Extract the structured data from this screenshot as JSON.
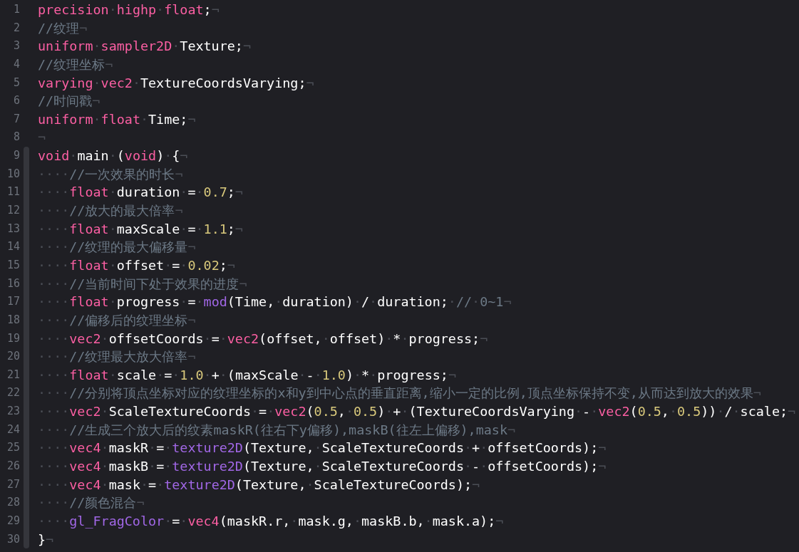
{
  "editor": {
    "lines": [
      {
        "number": "1",
        "tokens": [
          {
            "kind": "kw",
            "text": "precision"
          },
          {
            "kind": "ws",
            "text": "·"
          },
          {
            "kind": "kw",
            "text": "highp"
          },
          {
            "kind": "ws",
            "text": "·"
          },
          {
            "kind": "kw",
            "text": "float"
          },
          {
            "kind": "id",
            "text": ";"
          },
          {
            "kind": "ws",
            "text": "¬"
          }
        ]
      },
      {
        "number": "2",
        "tokens": [
          {
            "kind": "cm",
            "text": "//纹理"
          },
          {
            "kind": "ws",
            "text": "¬"
          }
        ]
      },
      {
        "number": "3",
        "tokens": [
          {
            "kind": "kw",
            "text": "uniform"
          },
          {
            "kind": "ws",
            "text": "·"
          },
          {
            "kind": "kw",
            "text": "sampler2D"
          },
          {
            "kind": "ws",
            "text": "·"
          },
          {
            "kind": "id",
            "text": "Texture;"
          },
          {
            "kind": "ws",
            "text": "¬"
          }
        ]
      },
      {
        "number": "4",
        "tokens": [
          {
            "kind": "cm",
            "text": "//纹理坐标"
          },
          {
            "kind": "ws",
            "text": "¬"
          }
        ]
      },
      {
        "number": "5",
        "tokens": [
          {
            "kind": "kw",
            "text": "varying"
          },
          {
            "kind": "ws",
            "text": "·"
          },
          {
            "kind": "kw",
            "text": "vec2"
          },
          {
            "kind": "ws",
            "text": "·"
          },
          {
            "kind": "id",
            "text": "TextureCoordsVarying;"
          },
          {
            "kind": "ws",
            "text": "¬"
          }
        ]
      },
      {
        "number": "6",
        "tokens": [
          {
            "kind": "cm",
            "text": "//时间戳"
          },
          {
            "kind": "ws",
            "text": "¬"
          }
        ]
      },
      {
        "number": "7",
        "tokens": [
          {
            "kind": "kw",
            "text": "uniform"
          },
          {
            "kind": "ws",
            "text": "·"
          },
          {
            "kind": "kw",
            "text": "float"
          },
          {
            "kind": "ws",
            "text": "·"
          },
          {
            "kind": "id",
            "text": "Time;"
          },
          {
            "kind": "ws",
            "text": "¬"
          }
        ]
      },
      {
        "number": "8",
        "tokens": [
          {
            "kind": "ws",
            "text": "¬"
          }
        ]
      }
    ],
    "block": {
      "lines": [
        {
          "number": "9",
          "tokens": [
            {
              "kind": "kw",
              "text": "void"
            },
            {
              "kind": "ws",
              "text": "·"
            },
            {
              "kind": "id",
              "text": "main"
            },
            {
              "kind": "ws",
              "text": "·"
            },
            {
              "kind": "id",
              "text": "("
            },
            {
              "kind": "kw",
              "text": "void"
            },
            {
              "kind": "id",
              "text": ")"
            },
            {
              "kind": "ws",
              "text": "·"
            },
            {
              "kind": "id",
              "text": "{"
            },
            {
              "kind": "ws",
              "text": "¬"
            }
          ]
        },
        {
          "number": "10",
          "tokens": [
            {
              "kind": "ws",
              "text": "····"
            },
            {
              "kind": "cm",
              "text": "//一次效果的时长"
            },
            {
              "kind": "ws",
              "text": "¬"
            }
          ]
        },
        {
          "number": "11",
          "tokens": [
            {
              "kind": "ws",
              "text": "····"
            },
            {
              "kind": "kw",
              "text": "float"
            },
            {
              "kind": "ws",
              "text": "·"
            },
            {
              "kind": "id",
              "text": "duration"
            },
            {
              "kind": "ws",
              "text": "·"
            },
            {
              "kind": "id",
              "text": "="
            },
            {
              "kind": "ws",
              "text": "·"
            },
            {
              "kind": "num",
              "text": "0.7"
            },
            {
              "kind": "id",
              "text": ";"
            },
            {
              "kind": "ws",
              "text": "¬"
            }
          ]
        },
        {
          "number": "12",
          "tokens": [
            {
              "kind": "ws",
              "text": "····"
            },
            {
              "kind": "cm",
              "text": "//放大的最大倍率"
            },
            {
              "kind": "ws",
              "text": "¬"
            }
          ]
        },
        {
          "number": "13",
          "tokens": [
            {
              "kind": "ws",
              "text": "····"
            },
            {
              "kind": "kw",
              "text": "float"
            },
            {
              "kind": "ws",
              "text": "·"
            },
            {
              "kind": "id",
              "text": "maxScale"
            },
            {
              "kind": "ws",
              "text": "·"
            },
            {
              "kind": "id",
              "text": "="
            },
            {
              "kind": "ws",
              "text": "·"
            },
            {
              "kind": "num",
              "text": "1.1"
            },
            {
              "kind": "id",
              "text": ";"
            },
            {
              "kind": "ws",
              "text": "¬"
            }
          ]
        },
        {
          "number": "14",
          "tokens": [
            {
              "kind": "ws",
              "text": "····"
            },
            {
              "kind": "cm",
              "text": "//纹理的最大偏移量"
            },
            {
              "kind": "ws",
              "text": "¬"
            }
          ]
        },
        {
          "number": "15",
          "tokens": [
            {
              "kind": "ws",
              "text": "····"
            },
            {
              "kind": "kw",
              "text": "float"
            },
            {
              "kind": "ws",
              "text": "·"
            },
            {
              "kind": "id",
              "text": "offset"
            },
            {
              "kind": "ws",
              "text": "·"
            },
            {
              "kind": "id",
              "text": "="
            },
            {
              "kind": "ws",
              "text": "·"
            },
            {
              "kind": "num",
              "text": "0.02"
            },
            {
              "kind": "id",
              "text": ";"
            },
            {
              "kind": "ws",
              "text": "¬"
            }
          ]
        },
        {
          "number": "16",
          "tokens": [
            {
              "kind": "ws",
              "text": "····"
            },
            {
              "kind": "cm",
              "text": "//当前时间下处于效果的进度"
            },
            {
              "kind": "ws",
              "text": "¬"
            }
          ]
        },
        {
          "number": "17",
          "tokens": [
            {
              "kind": "ws",
              "text": "····"
            },
            {
              "kind": "kw",
              "text": "float"
            },
            {
              "kind": "ws",
              "text": "·"
            },
            {
              "kind": "id",
              "text": "progress"
            },
            {
              "kind": "ws",
              "text": "·"
            },
            {
              "kind": "id",
              "text": "="
            },
            {
              "kind": "ws",
              "text": "·"
            },
            {
              "kind": "fn",
              "text": "mod"
            },
            {
              "kind": "id",
              "text": "(Time,"
            },
            {
              "kind": "ws",
              "text": "·"
            },
            {
              "kind": "id",
              "text": "duration)"
            },
            {
              "kind": "ws",
              "text": "·"
            },
            {
              "kind": "id",
              "text": "/"
            },
            {
              "kind": "ws",
              "text": "·"
            },
            {
              "kind": "id",
              "text": "duration;"
            },
            {
              "kind": "ws",
              "text": "·"
            },
            {
              "kind": "cm",
              "text": "//"
            },
            {
              "kind": "ws",
              "text": "·"
            },
            {
              "kind": "cm",
              "text": "0~1"
            },
            {
              "kind": "ws",
              "text": "¬"
            }
          ]
        },
        {
          "number": "18",
          "tokens": [
            {
              "kind": "ws",
              "text": "····"
            },
            {
              "kind": "cm",
              "text": "//偏移后的纹理坐标"
            },
            {
              "kind": "ws",
              "text": "¬"
            }
          ]
        },
        {
          "number": "19",
          "tokens": [
            {
              "kind": "ws",
              "text": "····"
            },
            {
              "kind": "kw",
              "text": "vec2"
            },
            {
              "kind": "ws",
              "text": "·"
            },
            {
              "kind": "id",
              "text": "offsetCoords"
            },
            {
              "kind": "ws",
              "text": "·"
            },
            {
              "kind": "id",
              "text": "="
            },
            {
              "kind": "ws",
              "text": "·"
            },
            {
              "kind": "kw",
              "text": "vec2"
            },
            {
              "kind": "id",
              "text": "(offset,"
            },
            {
              "kind": "ws",
              "text": "·"
            },
            {
              "kind": "id",
              "text": "offset)"
            },
            {
              "kind": "ws",
              "text": "·"
            },
            {
              "kind": "id",
              "text": "*"
            },
            {
              "kind": "ws",
              "text": "·"
            },
            {
              "kind": "id",
              "text": "progress;"
            },
            {
              "kind": "ws",
              "text": "¬"
            }
          ]
        },
        {
          "number": "20",
          "tokens": [
            {
              "kind": "ws",
              "text": "····"
            },
            {
              "kind": "cm",
              "text": "//纹理最大放大倍率"
            },
            {
              "kind": "ws",
              "text": "¬"
            }
          ]
        },
        {
          "number": "21",
          "tokens": [
            {
              "kind": "ws",
              "text": "····"
            },
            {
              "kind": "kw",
              "text": "float"
            },
            {
              "kind": "ws",
              "text": "·"
            },
            {
              "kind": "id",
              "text": "scale"
            },
            {
              "kind": "ws",
              "text": "·"
            },
            {
              "kind": "id",
              "text": "="
            },
            {
              "kind": "ws",
              "text": "·"
            },
            {
              "kind": "num",
              "text": "1.0"
            },
            {
              "kind": "ws",
              "text": "·"
            },
            {
              "kind": "id",
              "text": "+"
            },
            {
              "kind": "ws",
              "text": "·"
            },
            {
              "kind": "id",
              "text": "(maxScale"
            },
            {
              "kind": "ws",
              "text": "·"
            },
            {
              "kind": "id",
              "text": "-"
            },
            {
              "kind": "ws",
              "text": "·"
            },
            {
              "kind": "num",
              "text": "1.0"
            },
            {
              "kind": "id",
              "text": ")"
            },
            {
              "kind": "ws",
              "text": "·"
            },
            {
              "kind": "id",
              "text": "*"
            },
            {
              "kind": "ws",
              "text": "·"
            },
            {
              "kind": "id",
              "text": "progress;"
            },
            {
              "kind": "ws",
              "text": "¬"
            }
          ]
        },
        {
          "number": "22",
          "tokens": [
            {
              "kind": "ws",
              "text": "····"
            },
            {
              "kind": "cm",
              "text": "//分别将顶点坐标对应的纹理坐标的x和y到中心点的垂直距离,缩小一定的比例,顶点坐标保持不变,从而达到放大的效果"
            },
            {
              "kind": "ws",
              "text": "¬"
            }
          ]
        },
        {
          "number": "23",
          "tokens": [
            {
              "kind": "ws",
              "text": "····"
            },
            {
              "kind": "kw",
              "text": "vec2"
            },
            {
              "kind": "ws",
              "text": "·"
            },
            {
              "kind": "id",
              "text": "ScaleTextureCoords"
            },
            {
              "kind": "ws",
              "text": "·"
            },
            {
              "kind": "id",
              "text": "="
            },
            {
              "kind": "ws",
              "text": "·"
            },
            {
              "kind": "kw",
              "text": "vec2"
            },
            {
              "kind": "id",
              "text": "("
            },
            {
              "kind": "num",
              "text": "0.5"
            },
            {
              "kind": "id",
              "text": ","
            },
            {
              "kind": "ws",
              "text": "·"
            },
            {
              "kind": "num",
              "text": "0.5"
            },
            {
              "kind": "id",
              "text": ")"
            },
            {
              "kind": "ws",
              "text": "·"
            },
            {
              "kind": "id",
              "text": "+"
            },
            {
              "kind": "ws",
              "text": "·"
            },
            {
              "kind": "id",
              "text": "(TextureCoordsVarying"
            },
            {
              "kind": "ws",
              "text": "·"
            },
            {
              "kind": "id",
              "text": "-"
            },
            {
              "kind": "ws",
              "text": "·"
            },
            {
              "kind": "kw",
              "text": "vec2"
            },
            {
              "kind": "id",
              "text": "("
            },
            {
              "kind": "num",
              "text": "0.5"
            },
            {
              "kind": "id",
              "text": ","
            },
            {
              "kind": "ws",
              "text": "·"
            },
            {
              "kind": "num",
              "text": "0.5"
            },
            {
              "kind": "id",
              "text": "))"
            },
            {
              "kind": "ws",
              "text": "·"
            },
            {
              "kind": "id",
              "text": "/"
            },
            {
              "kind": "ws",
              "text": "·"
            },
            {
              "kind": "id",
              "text": "scale;"
            },
            {
              "kind": "ws",
              "text": "¬"
            }
          ]
        },
        {
          "number": "24",
          "tokens": [
            {
              "kind": "ws",
              "text": "····"
            },
            {
              "kind": "cm",
              "text": "//生成三个放大后的纹素maskR(往右下y偏移),maskB(往左上偏移),mask"
            },
            {
              "kind": "ws",
              "text": "¬"
            }
          ]
        },
        {
          "number": "25",
          "tokens": [
            {
              "kind": "ws",
              "text": "····"
            },
            {
              "kind": "kw",
              "text": "vec4"
            },
            {
              "kind": "ws",
              "text": "·"
            },
            {
              "kind": "id",
              "text": "maskR"
            },
            {
              "kind": "ws",
              "text": "·"
            },
            {
              "kind": "id",
              "text": "="
            },
            {
              "kind": "ws",
              "text": "·"
            },
            {
              "kind": "fn",
              "text": "texture2D"
            },
            {
              "kind": "id",
              "text": "(Texture,"
            },
            {
              "kind": "ws",
              "text": "·"
            },
            {
              "kind": "id",
              "text": "ScaleTextureCoords"
            },
            {
              "kind": "ws",
              "text": "·"
            },
            {
              "kind": "id",
              "text": "+"
            },
            {
              "kind": "ws",
              "text": "·"
            },
            {
              "kind": "id",
              "text": "offsetCoords);"
            },
            {
              "kind": "ws",
              "text": "¬"
            }
          ]
        },
        {
          "number": "26",
          "tokens": [
            {
              "kind": "ws",
              "text": "····"
            },
            {
              "kind": "kw",
              "text": "vec4"
            },
            {
              "kind": "ws",
              "text": "·"
            },
            {
              "kind": "id",
              "text": "maskB"
            },
            {
              "kind": "ws",
              "text": "·"
            },
            {
              "kind": "id",
              "text": "="
            },
            {
              "kind": "ws",
              "text": "·"
            },
            {
              "kind": "fn",
              "text": "texture2D"
            },
            {
              "kind": "id",
              "text": "(Texture,"
            },
            {
              "kind": "ws",
              "text": "·"
            },
            {
              "kind": "id",
              "text": "ScaleTextureCoords"
            },
            {
              "kind": "ws",
              "text": "·"
            },
            {
              "kind": "id",
              "text": "-"
            },
            {
              "kind": "ws",
              "text": "·"
            },
            {
              "kind": "id",
              "text": "offsetCoords);"
            },
            {
              "kind": "ws",
              "text": "¬"
            }
          ]
        },
        {
          "number": "27",
          "tokens": [
            {
              "kind": "ws",
              "text": "····"
            },
            {
              "kind": "kw",
              "text": "vec4"
            },
            {
              "kind": "ws",
              "text": "·"
            },
            {
              "kind": "id",
              "text": "mask"
            },
            {
              "kind": "ws",
              "text": "·"
            },
            {
              "kind": "id",
              "text": "="
            },
            {
              "kind": "ws",
              "text": "·"
            },
            {
              "kind": "fn",
              "text": "texture2D"
            },
            {
              "kind": "id",
              "text": "(Texture,"
            },
            {
              "kind": "ws",
              "text": "·"
            },
            {
              "kind": "id",
              "text": "ScaleTextureCoords);"
            },
            {
              "kind": "ws",
              "text": "¬"
            }
          ]
        },
        {
          "number": "28",
          "tokens": [
            {
              "kind": "ws",
              "text": "····"
            },
            {
              "kind": "cm",
              "text": "//颜色混合"
            },
            {
              "kind": "ws",
              "text": "¬"
            }
          ]
        },
        {
          "number": "29",
          "tokens": [
            {
              "kind": "ws",
              "text": "····"
            },
            {
              "kind": "fn",
              "text": "gl_FragColor"
            },
            {
              "kind": "ws",
              "text": "·"
            },
            {
              "kind": "id",
              "text": "="
            },
            {
              "kind": "ws",
              "text": "·"
            },
            {
              "kind": "kw",
              "text": "vec4"
            },
            {
              "kind": "id",
              "text": "(maskR.r,"
            },
            {
              "kind": "ws",
              "text": "·"
            },
            {
              "kind": "id",
              "text": "mask.g,"
            },
            {
              "kind": "ws",
              "text": "·"
            },
            {
              "kind": "id",
              "text": "maskB.b,"
            },
            {
              "kind": "ws",
              "text": "·"
            },
            {
              "kind": "id",
              "text": "mask.a);"
            },
            {
              "kind": "ws",
              "text": "¬"
            }
          ]
        },
        {
          "number": "30",
          "tokens": [
            {
              "kind": "id",
              "text": "}"
            },
            {
              "kind": "ws",
              "text": "¬"
            }
          ]
        }
      ]
    }
  }
}
